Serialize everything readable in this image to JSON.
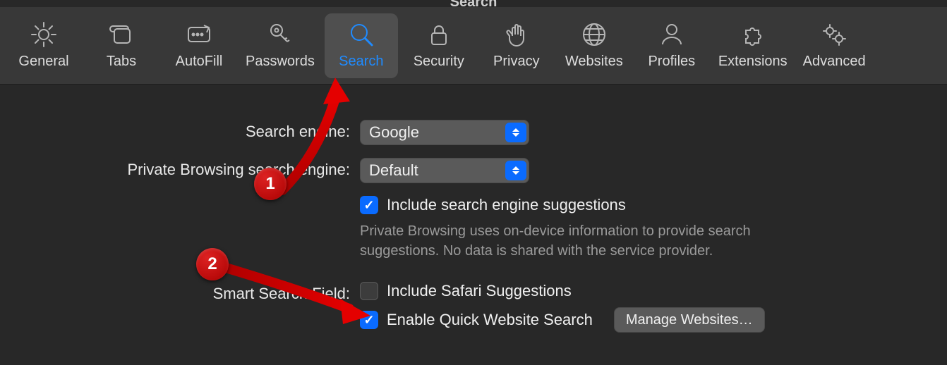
{
  "title": "Search",
  "tabs": [
    {
      "label": "General"
    },
    {
      "label": "Tabs"
    },
    {
      "label": "AutoFill"
    },
    {
      "label": "Passwords"
    },
    {
      "label": "Search"
    },
    {
      "label": "Security"
    },
    {
      "label": "Privacy"
    },
    {
      "label": "Websites"
    },
    {
      "label": "Profiles"
    },
    {
      "label": "Extensions"
    },
    {
      "label": "Advanced"
    }
  ],
  "form": {
    "search_engine": {
      "label": "Search engine:",
      "value": "Google"
    },
    "private_engine": {
      "label": "Private Browsing search engine:",
      "value": "Default"
    },
    "include_engine_suggestions": {
      "label": "Include search engine suggestions",
      "checked": true
    },
    "private_helper": "Private Browsing uses on-device information to provide search suggestions. No data is shared with the service provider.",
    "smart_field_label": "Smart Search Field:",
    "include_safari_suggestions": {
      "label": "Include Safari Suggestions",
      "checked": false
    },
    "enable_quick_website_search": {
      "label": "Enable Quick Website Search",
      "checked": true
    },
    "manage_websites_button": "Manage Websites…"
  },
  "annotations": {
    "one": "1",
    "two": "2"
  }
}
